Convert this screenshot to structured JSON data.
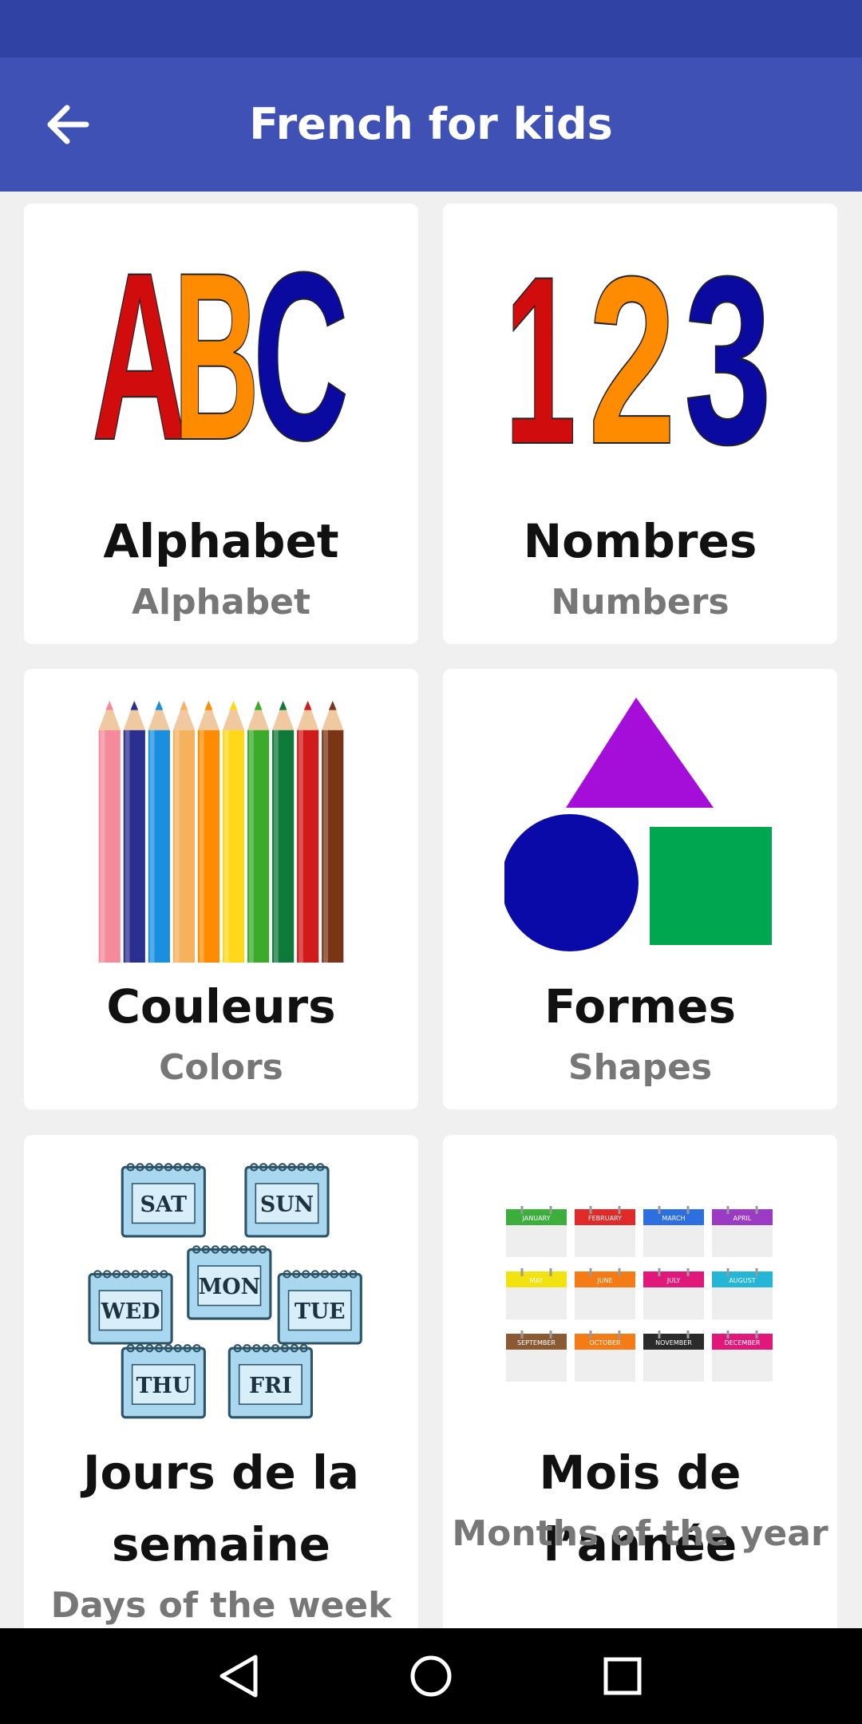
{
  "appbar": {
    "title": "French for kids",
    "back_icon": "arrow-left-icon"
  },
  "colors": {
    "status_bar": "#3043a5",
    "app_bar": "#3f51b5",
    "background": "#f0f0f0"
  },
  "cards": [
    {
      "title": "Alphabet",
      "subtitle": "Alphabet",
      "image": "abc-letters-image",
      "image_text": "ABC"
    },
    {
      "title": "Nombres",
      "subtitle": "Numbers",
      "image": "123-numbers-image",
      "image_text": "123"
    },
    {
      "title": "Couleurs",
      "subtitle": "Colors",
      "image": "colored-pencils-image"
    },
    {
      "title": "Formes",
      "subtitle": "Shapes",
      "image": "shapes-image"
    },
    {
      "title": "Jours de la semaine",
      "subtitle": "Days of the week",
      "image": "weekday-calendars-image",
      "days": [
        "SAT",
        "SUN",
        "WED",
        "MON",
        "TUE",
        "THU",
        "FRI"
      ]
    },
    {
      "title": "Mois de l’année",
      "subtitle": "Months of the year",
      "image": "month-calendars-image",
      "months": [
        "JANUARY",
        "FEBRUARY",
        "MARCH",
        "APRIL",
        "MAY",
        "JUNE",
        "JULY",
        "AUGUST",
        "SEPTEMBER",
        "OCTOBER",
        "NOVEMBER",
        "DECEMBER"
      ]
    }
  ],
  "navbar": {
    "back": "nav-back-icon",
    "home": "nav-home-icon",
    "recents": "nav-recents-icon"
  }
}
